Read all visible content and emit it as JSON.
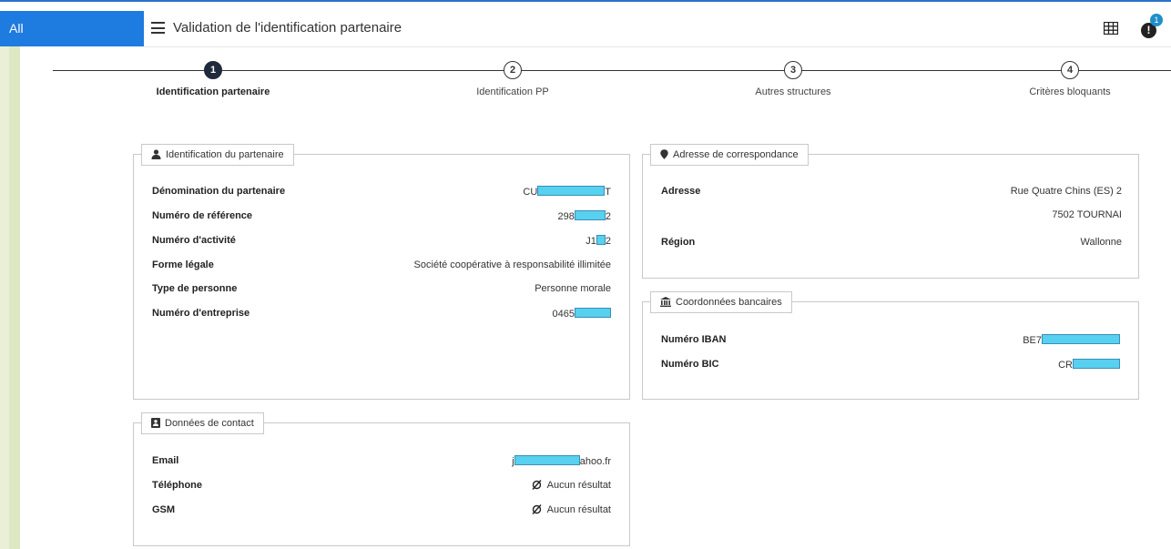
{
  "app": {
    "all_label": "All",
    "title": "Validation de l'identification partenaire",
    "notif_count": "1"
  },
  "icons": {
    "menu": "hamburger-icon",
    "grid": "grid-icon",
    "notification": "exclamation-icon"
  },
  "steps": [
    {
      "num": "1",
      "label": "Identification partenaire",
      "active": true
    },
    {
      "num": "2",
      "label": "Identification PP",
      "active": false
    },
    {
      "num": "3",
      "label": "Autres structures",
      "active": false
    },
    {
      "num": "4",
      "label": "Critères bloquants",
      "active": false
    }
  ],
  "partner": {
    "legend": "Identification du partenaire",
    "rows": [
      {
        "key": "Dénomination du partenaire",
        "prefix": "CU",
        "suffix": "T"
      },
      {
        "key": "Numéro de référence",
        "prefix": "298",
        "suffix": "2"
      },
      {
        "key": "Numéro d'activité",
        "prefix": "J1",
        "suffix": "2"
      },
      {
        "key": "Forme légale",
        "value": "Société coopérative à responsabilité illimitée"
      },
      {
        "key": "Type de personne",
        "value": "Personne morale"
      },
      {
        "key": "Numéro d'entreprise",
        "prefix": "0465",
        "suffix": ""
      }
    ]
  },
  "address": {
    "legend": "Adresse de correspondance",
    "adresse_label": "Adresse",
    "adresse_line1": "Rue Quatre Chins (ES) 2",
    "adresse_line2": "7502 TOURNAI",
    "region_label": "Région",
    "region_value": "Wallonne"
  },
  "bank": {
    "legend": "Coordonnées bancaires",
    "iban_label": "Numéro IBAN",
    "iban_prefix": "BE7",
    "bic_label": "Numéro BIC",
    "bic_prefix": "CR"
  },
  "contact": {
    "legend": "Données de contact",
    "email_label": "Email",
    "email_prefix": "j",
    "email_suffix": "ahoo.fr",
    "phone_label": "Téléphone",
    "phone_value": "Aucun résultat",
    "gsm_label": "GSM",
    "gsm_value": "Aucun résultat"
  },
  "colors": {
    "accent": "#1e7be0",
    "redaction": "#58d0ef",
    "badge": "#1f8fc9",
    "active_step": "#1f2a3c"
  }
}
